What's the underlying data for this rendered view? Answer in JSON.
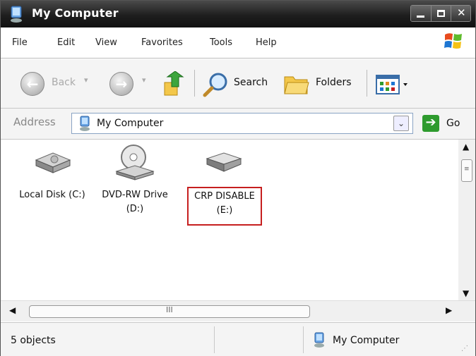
{
  "window": {
    "title": "My Computer"
  },
  "menu": [
    "File",
    "Edit",
    "View",
    "Favorites",
    "Tools",
    "Help"
  ],
  "toolbar": {
    "back_label": "Back",
    "search_label": "Search",
    "folders_label": "Folders"
  },
  "address": {
    "label": "Address",
    "value": "My Computer",
    "go_label": "Go"
  },
  "drives": [
    {
      "label_line1": "Local Disk (C:)",
      "label_line2": ""
    },
    {
      "label_line1": "DVD-RW Drive",
      "label_line2": "(D:)"
    },
    {
      "label_line1": "CRP DISABLE",
      "label_line2": "(E:)"
    }
  ],
  "hscroll": {
    "grip": "III"
  },
  "status": {
    "count": "5 objects",
    "location": "My Computer"
  },
  "colors": {
    "highlight": "#c61f1f",
    "titlebar": "#1e1e1e",
    "go": "#2e9b2e"
  },
  "icons": [
    "computer-icon",
    "minimize-icon",
    "maximize-icon",
    "close-icon",
    "windows-logo-icon",
    "back-icon",
    "forward-icon",
    "up-folder-icon",
    "search-icon",
    "folders-icon",
    "views-icon",
    "go-icon",
    "hard-disk-icon",
    "dvd-drive-icon",
    "removable-disk-icon"
  ]
}
